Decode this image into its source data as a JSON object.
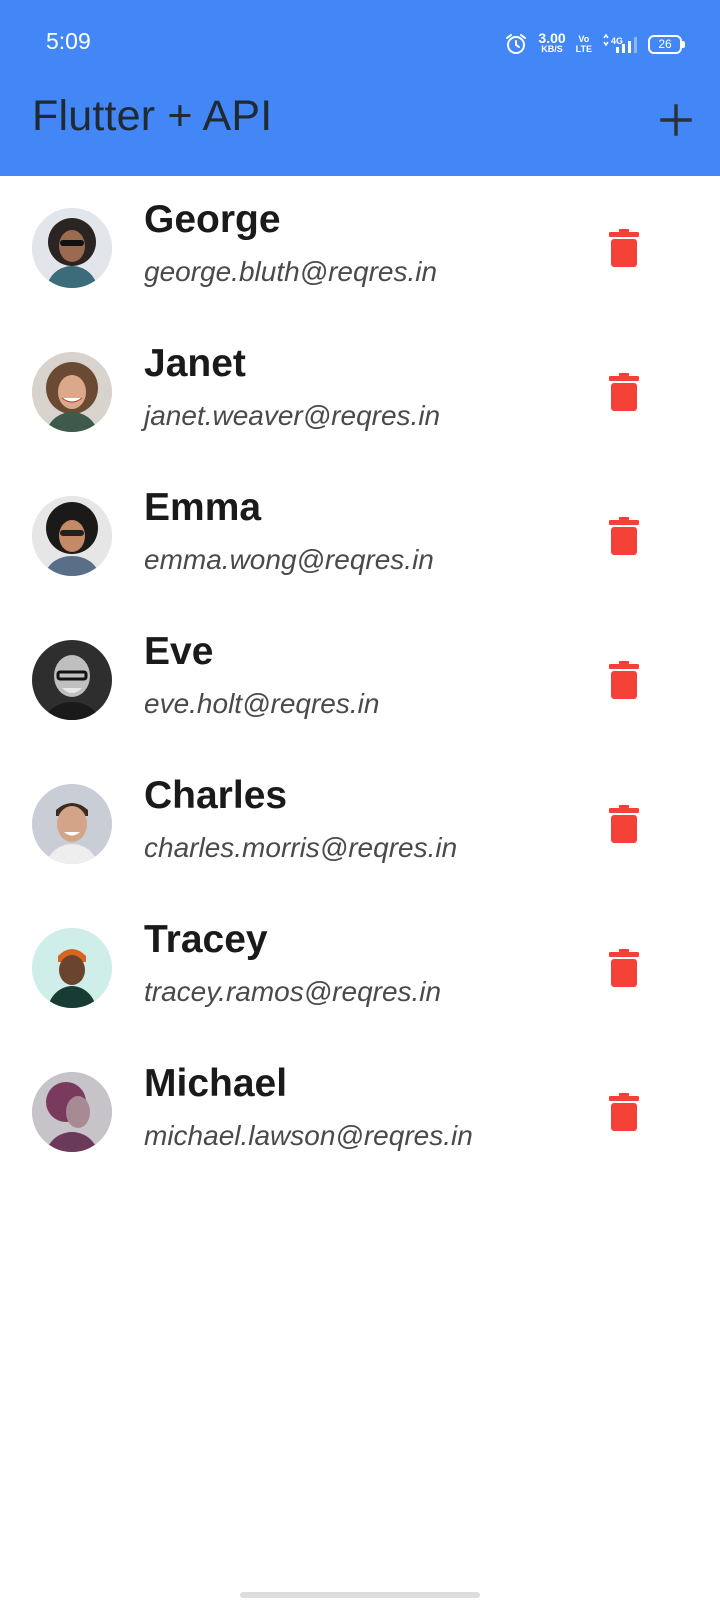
{
  "status_bar": {
    "time": "5:09",
    "speed_value": "3.00",
    "speed_unit": "KB/S",
    "volte_top": "Vo",
    "volte_bottom": "LTE",
    "network": "4G",
    "battery": "26",
    "icons": [
      "alarm-icon",
      "volte-icon",
      "signal-icon",
      "battery-icon"
    ]
  },
  "app_bar": {
    "title": "Flutter + API",
    "add_icon": "plus-icon",
    "background": "#4287f5"
  },
  "users": [
    {
      "name": "George",
      "email": "george.bluth@reqres.in",
      "avatar_color": "#3c6b7a"
    },
    {
      "name": "Janet",
      "email": "janet.weaver@reqres.in",
      "avatar_color": "#8a6a4e"
    },
    {
      "name": "Emma",
      "email": "emma.wong@reqres.in",
      "avatar_color": "#5a6f87"
    },
    {
      "name": "Eve",
      "email": "eve.holt@reqres.in",
      "avatar_color": "#3a3a3a"
    },
    {
      "name": "Charles",
      "email": "charles.morris@reqres.in",
      "avatar_color": "#c9cdd6"
    },
    {
      "name": "Tracey",
      "email": "tracey.ramos@reqres.in",
      "avatar_color": "#cfeeea"
    },
    {
      "name": "Michael",
      "email": "michael.lawson@reqres.in",
      "avatar_color": "#6b3a5a"
    }
  ],
  "delete_icon": "trash-icon",
  "delete_color": "#f44336"
}
